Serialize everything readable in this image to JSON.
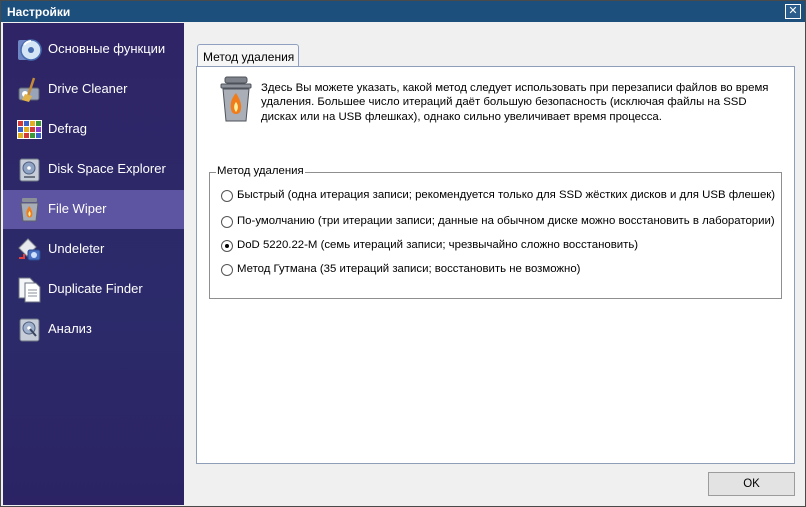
{
  "window": {
    "title": "Настройки"
  },
  "sidebar": {
    "items": [
      {
        "label": "Основные функции",
        "icon": "disc-icon",
        "active": false
      },
      {
        "label": "Drive Cleaner",
        "icon": "broom-drive-icon",
        "active": false
      },
      {
        "label": "Defrag",
        "icon": "defrag-grid-icon",
        "active": false
      },
      {
        "label": "Disk Space Explorer",
        "icon": "disk-explorer-icon",
        "active": false
      },
      {
        "label": "File Wiper",
        "icon": "file-wiper-icon",
        "active": true
      },
      {
        "label": "Undeleter",
        "icon": "undeleter-icon",
        "active": false
      },
      {
        "label": "Duplicate Finder",
        "icon": "duplicate-docs-icon",
        "active": false
      },
      {
        "label": "Анализ",
        "icon": "analysis-disk-icon",
        "active": false
      }
    ]
  },
  "main": {
    "tab_label": "Метод удаления",
    "description": "Здесь Вы можете указать, какой метод следует использовать при перезаписи файлов во время удаления. Большее число итераций даёт большую безопасность (исключая файлы на SSD дисках или на USB флешках), однако сильно увеличивает время процесса.",
    "group_title": "Метод удаления",
    "options": [
      {
        "label": "Быстрый (одна итерация записи; рекомендуется только для SSD жёстких дисков и для USB флешек)",
        "selected": false
      },
      {
        "label": "По-умолчанию (три итерации записи; данные на обычном диске можно восстановить в лаборатории)",
        "selected": false
      },
      {
        "label": "DoD 5220.22-M (семь итераций записи; чрезвычайно сложно восстановить)",
        "selected": true
      },
      {
        "label": "Метод Гутмана (35 итераций записи; восстановить не возможно)",
        "selected": false
      }
    ]
  },
  "footer": {
    "ok_label": "OK"
  },
  "colors": {
    "sidebar_bg": "#2f2666",
    "sidebar_active": "#5e55a2",
    "titlebar": "#1d4f7d",
    "flame": "#f07c1c"
  }
}
